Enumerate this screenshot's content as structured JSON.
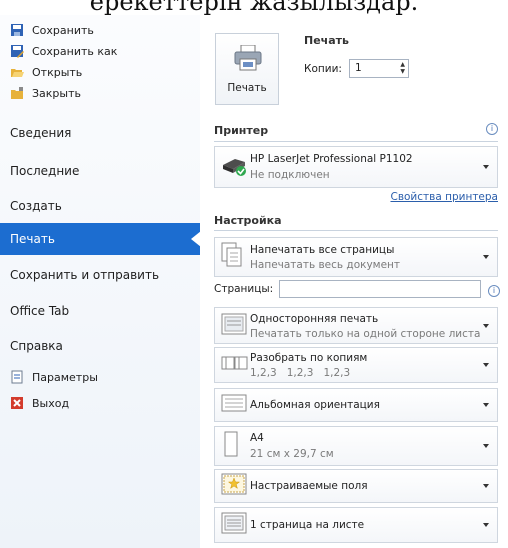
{
  "banner_text": "ерекеттерін жазылыздар.",
  "left_menu": {
    "commands": [
      {
        "label": "Сохранить",
        "icon": "save-icon"
      },
      {
        "label": "Сохранить как",
        "icon": "save-as-icon"
      },
      {
        "label": "Открыть",
        "icon": "open-folder-icon"
      },
      {
        "label": "Закрыть",
        "icon": "close-folder-icon"
      }
    ],
    "items": [
      {
        "label": "Сведения"
      },
      {
        "label": "Последние"
      },
      {
        "label": "Создать"
      },
      {
        "label": "Печать",
        "selected": true
      },
      {
        "label": "Сохранить и отправить"
      },
      {
        "label": "Office Tab"
      },
      {
        "label": "Справка"
      }
    ],
    "bottom_commands": [
      {
        "label": "Параметры",
        "icon": "options-icon"
      },
      {
        "label": "Выход",
        "icon": "exit-icon"
      }
    ]
  },
  "print": {
    "section_title": "Печать",
    "button_label": "Печать",
    "copies_label": "Копии:",
    "copies_value": "1"
  },
  "printer": {
    "section_title": "Принтер",
    "info_icon": "info-icon",
    "name": "HP LaserJet Professional P1102",
    "status": "Не подключен",
    "properties_link": "Свойства принтера"
  },
  "settings": {
    "section_title": "Настройка",
    "pages_label": "Страницы:",
    "pages_value": "",
    "dropdowns": [
      {
        "title": "Напечатать все страницы",
        "subtitle": "Напечатать весь документ",
        "icon": "pages-icon"
      },
      {
        "title": "Односторонняя печать",
        "subtitle": "Печатать только на одной стороне листа",
        "icon": "one-sided-icon"
      },
      {
        "title": "Разобрать по копиям",
        "subtitle": "1,2,3   1,2,3   1,2,3",
        "icon": "collate-icon"
      },
      {
        "title": "Альбомная ориентация",
        "subtitle": "",
        "icon": "landscape-icon"
      },
      {
        "title": "A4",
        "subtitle": "21 см x 29,7 см",
        "icon": "paper-size-icon"
      },
      {
        "title": "Настраиваемые поля",
        "subtitle": "",
        "icon": "margins-icon"
      },
      {
        "title": "1 страница на листе",
        "subtitle": "",
        "icon": "pages-per-sheet-icon"
      }
    ]
  },
  "colors": {
    "accent": "#1c6dd0",
    "link": "#2b5eab",
    "status_ok": "#2fa84f"
  }
}
